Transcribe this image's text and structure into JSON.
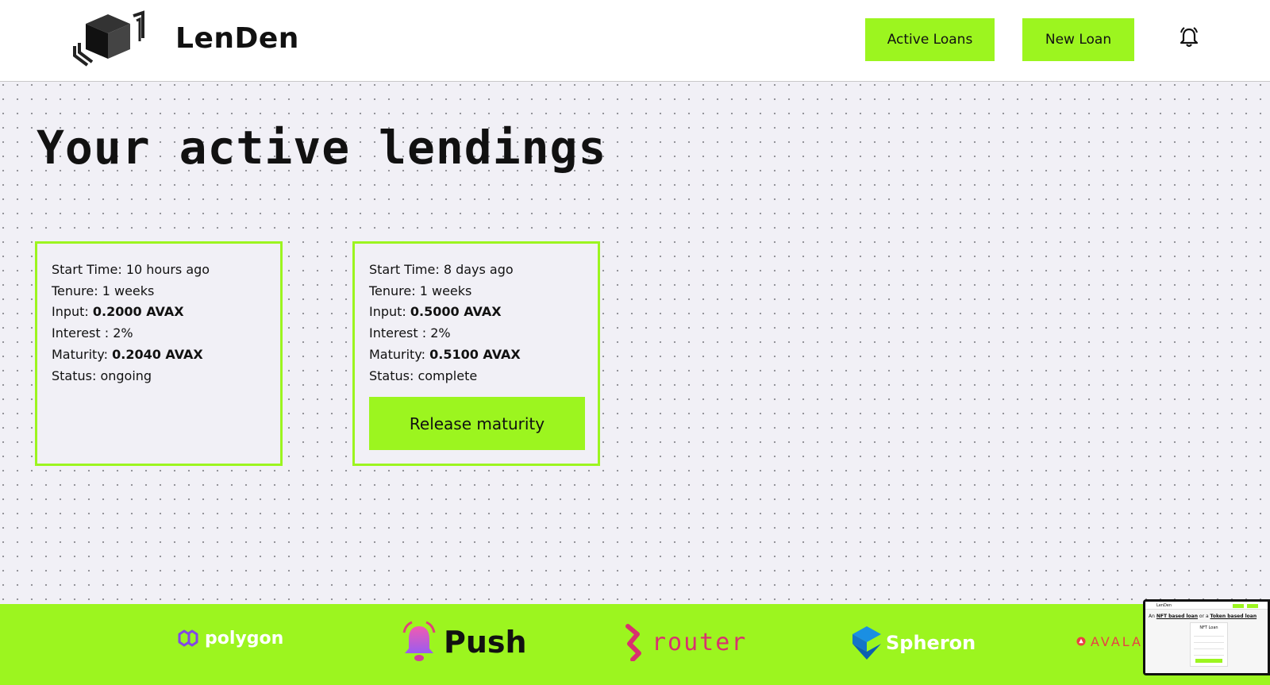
{
  "header": {
    "brand": "LenDen",
    "nav": {
      "active_loans": "Active Loans",
      "new_loan": "New Loan"
    },
    "notification_icon": "bell-icon",
    "logo_icon": "cube-logo-icon"
  },
  "main": {
    "title": "Your active lendings",
    "loans": [
      {
        "start_time_label": "Start Time: ",
        "start_time": "10 hours ago",
        "tenure_label": "Tenure: ",
        "tenure": "1 weeks",
        "input_label": "Input: ",
        "input": "0.2000 AVAX",
        "interest_label": "Interest : ",
        "interest": "2%",
        "maturity_label": "Maturity: ",
        "maturity": "0.2040 AVAX",
        "status_label": "Status: ",
        "status": "ongoing"
      },
      {
        "start_time_label": "Start Time: ",
        "start_time": "8 days ago",
        "tenure_label": "Tenure: ",
        "tenure": "1 weeks",
        "input_label": "Input: ",
        "input": "0.5000 AVAX",
        "interest_label": "Interest : ",
        "interest": "2%",
        "maturity_label": "Maturity: ",
        "maturity": "0.5100 AVAX",
        "status_label": "Status: ",
        "status": "complete",
        "action": "Release maturity"
      }
    ]
  },
  "footer": {
    "sponsors": [
      {
        "name": "polygon",
        "icon": "polygon-logo-icon",
        "color": "#8247e5"
      },
      {
        "name": "Push",
        "icon": "push-bell-logo-icon",
        "color": "#cf59e1"
      },
      {
        "name": "router",
        "icon": "router-logo-icon",
        "color": "#d8316f"
      },
      {
        "name": "Spheron",
        "icon": "spheron-logo-icon",
        "color": "#1a8fe3"
      },
      {
        "name": "AVALA",
        "icon": "avalanche-logo-icon",
        "color": "#e84142"
      }
    ]
  },
  "preview": {
    "brand": "LenDen",
    "headline_pre": "An ",
    "headline_nft": "NFT based loan",
    "headline_mid": " or a ",
    "headline_token": "Token based loan",
    "form_title": "NFT Loan"
  },
  "colors": {
    "accent": "#9cf51f",
    "background": "#f1f0f6",
    "text": "#111111"
  }
}
